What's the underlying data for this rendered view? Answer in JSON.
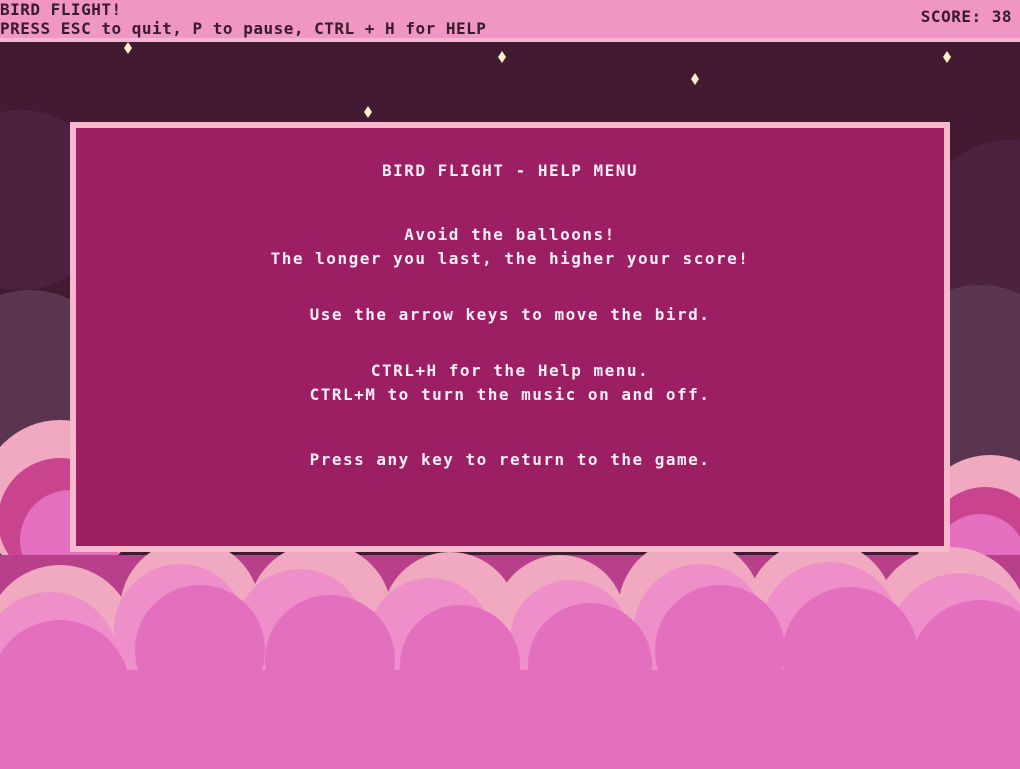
{
  "hud": {
    "title": "BIRD FLIGHT!",
    "controls": "PRESS ESC to quit, P to pause, CTRL + H for HELP",
    "score_label": "SCORE:",
    "score_value": "38"
  },
  "help_menu": {
    "title": "BIRD FLIGHT - HELP MENU",
    "line_avoid": "Avoid the balloons!",
    "line_score": "The longer you last, the higher your score!",
    "line_move": "Use the arrow keys to move the bird.",
    "line_help": "CTRL+H for the Help menu.",
    "line_music": "CTRL+M to turn the music on and off.",
    "line_return": "Press any key to return to the game."
  },
  "colors": {
    "sky_top": "#421b33",
    "cloud_dark": "#5a3550",
    "cloud_pink": "#e46fbf",
    "cloud_light": "#f0a9c0",
    "panel_bg": "#9c1f63",
    "panel_border": "#f7b8cb",
    "hud_bg": "#ef96c3"
  }
}
